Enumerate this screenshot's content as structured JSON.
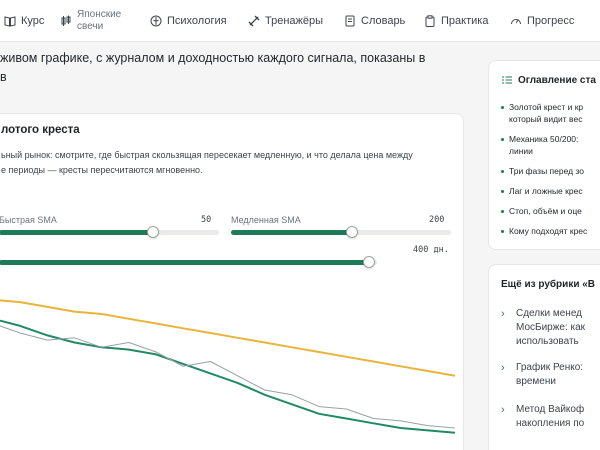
{
  "nav": {
    "items": [
      {
        "label": "Курс",
        "icon": "book-icon"
      },
      {
        "label": "Японские свечи",
        "line1": "Японские",
        "line2": "свечи",
        "icon": "candles-icon"
      },
      {
        "label": "Психология",
        "icon": "brain-icon"
      },
      {
        "label": "Тренажёры",
        "icon": "dumbbell-icon"
      },
      {
        "label": "Словарь",
        "icon": "dictionary-icon"
      },
      {
        "label": "Практика",
        "icon": "clipboard-icon"
      },
      {
        "label": "Прогресс",
        "icon": "gauge-icon"
      }
    ]
  },
  "intro": {
    "line1": "живом графике, с журналом и доходностью каждого сигнала, показаны в",
    "line2": "в"
  },
  "card": {
    "title": "лотого креста",
    "desc_line1": "ьный рынок: смотрите, где быстрая скользящая пересекает медленную, и что делала цена между",
    "desc_line2": "е периоды — кресты пересчитаются мгновенно.",
    "fast_sma": {
      "label": "Быстрая SMA",
      "value": "50",
      "fraction": 0.7
    },
    "slow_sma": {
      "label": "Медленная SMA",
      "value": "200",
      "fraction": 0.55
    },
    "period": {
      "value": "400 дн.",
      "fraction": 0.98
    }
  },
  "toc": {
    "title": "Оглавление ста",
    "items": [
      {
        "line1": "Золотой крест и кр",
        "line2": "который видит вес"
      },
      {
        "line1": "Механика 50/200:",
        "line2": "линии"
      },
      {
        "line1": "Три фазы перед зо",
        "line2": ""
      },
      {
        "line1": "Лаг и ложные крес",
        "line2": ""
      },
      {
        "line1": "Стоп, объём и оце",
        "line2": ""
      },
      {
        "line1": "Кому подходят крес",
        "line2": ""
      }
    ]
  },
  "more": {
    "title": "Ещё из рубрики «В",
    "items": [
      {
        "text": "Сделки менед\nМосБирже: как\nиспользовать"
      },
      {
        "text": "График Ренко:\nвремени"
      },
      {
        "text": "Метод Вайкоф\nнакопления по"
      }
    ]
  },
  "colors": {
    "accent": "#1f7a58",
    "slow_line": "#e8b43a",
    "fast_line": "#1f8a64",
    "price_line": "#9aa0a6"
  },
  "chart_data": {
    "type": "line",
    "series": [
      {
        "values": [
          100,
          99,
          97,
          95,
          94,
          92,
          90,
          88,
          86,
          84,
          82,
          80,
          78,
          76,
          74,
          72,
          70,
          68
        ]
      },
      {
        "values": [
          92,
          89,
          85,
          82,
          80,
          79,
          77,
          73,
          69,
          65,
          60,
          56,
          52,
          50,
          48,
          46,
          45,
          44
        ]
      },
      {
        "values": [
          90,
          86,
          83,
          84,
          80,
          82,
          78,
          72,
          74,
          68,
          62,
          60,
          55,
          54,
          50,
          49,
          47,
          46
        ]
      }
    ]
  }
}
